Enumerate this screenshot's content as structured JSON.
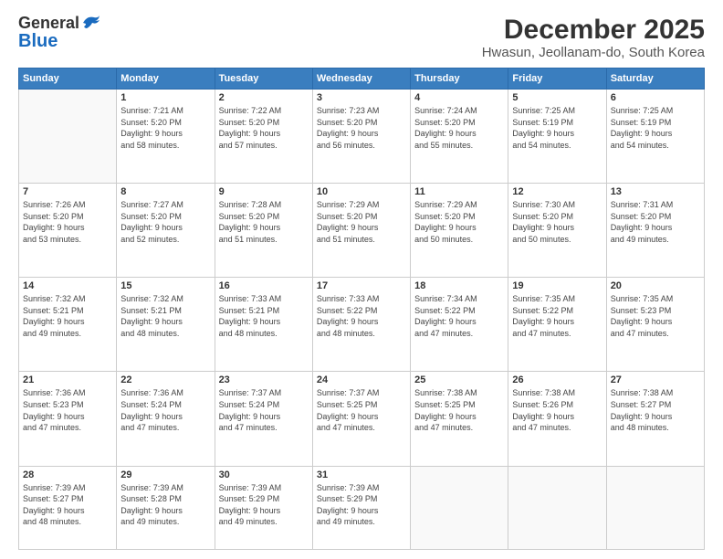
{
  "logo": {
    "general": "General",
    "blue": "Blue"
  },
  "title": "December 2025",
  "subtitle": "Hwasun, Jeollanam-do, South Korea",
  "days_of_week": [
    "Sunday",
    "Monday",
    "Tuesday",
    "Wednesday",
    "Thursday",
    "Friday",
    "Saturday"
  ],
  "weeks": [
    [
      {
        "day": "",
        "info": ""
      },
      {
        "day": "1",
        "info": "Sunrise: 7:21 AM\nSunset: 5:20 PM\nDaylight: 9 hours\nand 58 minutes."
      },
      {
        "day": "2",
        "info": "Sunrise: 7:22 AM\nSunset: 5:20 PM\nDaylight: 9 hours\nand 57 minutes."
      },
      {
        "day": "3",
        "info": "Sunrise: 7:23 AM\nSunset: 5:20 PM\nDaylight: 9 hours\nand 56 minutes."
      },
      {
        "day": "4",
        "info": "Sunrise: 7:24 AM\nSunset: 5:20 PM\nDaylight: 9 hours\nand 55 minutes."
      },
      {
        "day": "5",
        "info": "Sunrise: 7:25 AM\nSunset: 5:19 PM\nDaylight: 9 hours\nand 54 minutes."
      },
      {
        "day": "6",
        "info": "Sunrise: 7:25 AM\nSunset: 5:19 PM\nDaylight: 9 hours\nand 54 minutes."
      }
    ],
    [
      {
        "day": "7",
        "info": "Sunrise: 7:26 AM\nSunset: 5:20 PM\nDaylight: 9 hours\nand 53 minutes."
      },
      {
        "day": "8",
        "info": "Sunrise: 7:27 AM\nSunset: 5:20 PM\nDaylight: 9 hours\nand 52 minutes."
      },
      {
        "day": "9",
        "info": "Sunrise: 7:28 AM\nSunset: 5:20 PM\nDaylight: 9 hours\nand 51 minutes."
      },
      {
        "day": "10",
        "info": "Sunrise: 7:29 AM\nSunset: 5:20 PM\nDaylight: 9 hours\nand 51 minutes."
      },
      {
        "day": "11",
        "info": "Sunrise: 7:29 AM\nSunset: 5:20 PM\nDaylight: 9 hours\nand 50 minutes."
      },
      {
        "day": "12",
        "info": "Sunrise: 7:30 AM\nSunset: 5:20 PM\nDaylight: 9 hours\nand 50 minutes."
      },
      {
        "day": "13",
        "info": "Sunrise: 7:31 AM\nSunset: 5:20 PM\nDaylight: 9 hours\nand 49 minutes."
      }
    ],
    [
      {
        "day": "14",
        "info": "Sunrise: 7:32 AM\nSunset: 5:21 PM\nDaylight: 9 hours\nand 49 minutes."
      },
      {
        "day": "15",
        "info": "Sunrise: 7:32 AM\nSunset: 5:21 PM\nDaylight: 9 hours\nand 48 minutes."
      },
      {
        "day": "16",
        "info": "Sunrise: 7:33 AM\nSunset: 5:21 PM\nDaylight: 9 hours\nand 48 minutes."
      },
      {
        "day": "17",
        "info": "Sunrise: 7:33 AM\nSunset: 5:22 PM\nDaylight: 9 hours\nand 48 minutes."
      },
      {
        "day": "18",
        "info": "Sunrise: 7:34 AM\nSunset: 5:22 PM\nDaylight: 9 hours\nand 47 minutes."
      },
      {
        "day": "19",
        "info": "Sunrise: 7:35 AM\nSunset: 5:22 PM\nDaylight: 9 hours\nand 47 minutes."
      },
      {
        "day": "20",
        "info": "Sunrise: 7:35 AM\nSunset: 5:23 PM\nDaylight: 9 hours\nand 47 minutes."
      }
    ],
    [
      {
        "day": "21",
        "info": "Sunrise: 7:36 AM\nSunset: 5:23 PM\nDaylight: 9 hours\nand 47 minutes."
      },
      {
        "day": "22",
        "info": "Sunrise: 7:36 AM\nSunset: 5:24 PM\nDaylight: 9 hours\nand 47 minutes."
      },
      {
        "day": "23",
        "info": "Sunrise: 7:37 AM\nSunset: 5:24 PM\nDaylight: 9 hours\nand 47 minutes."
      },
      {
        "day": "24",
        "info": "Sunrise: 7:37 AM\nSunset: 5:25 PM\nDaylight: 9 hours\nand 47 minutes."
      },
      {
        "day": "25",
        "info": "Sunrise: 7:38 AM\nSunset: 5:25 PM\nDaylight: 9 hours\nand 47 minutes."
      },
      {
        "day": "26",
        "info": "Sunrise: 7:38 AM\nSunset: 5:26 PM\nDaylight: 9 hours\nand 47 minutes."
      },
      {
        "day": "27",
        "info": "Sunrise: 7:38 AM\nSunset: 5:27 PM\nDaylight: 9 hours\nand 48 minutes."
      }
    ],
    [
      {
        "day": "28",
        "info": "Sunrise: 7:39 AM\nSunset: 5:27 PM\nDaylight: 9 hours\nand 48 minutes."
      },
      {
        "day": "29",
        "info": "Sunrise: 7:39 AM\nSunset: 5:28 PM\nDaylight: 9 hours\nand 49 minutes."
      },
      {
        "day": "30",
        "info": "Sunrise: 7:39 AM\nSunset: 5:29 PM\nDaylight: 9 hours\nand 49 minutes."
      },
      {
        "day": "31",
        "info": "Sunrise: 7:39 AM\nSunset: 5:29 PM\nDaylight: 9 hours\nand 49 minutes."
      },
      {
        "day": "",
        "info": ""
      },
      {
        "day": "",
        "info": ""
      },
      {
        "day": "",
        "info": ""
      }
    ]
  ],
  "colors": {
    "header_bg": "#3a7ebf",
    "header_text": "#ffffff",
    "border": "#cccccc",
    "text": "#333333",
    "empty_bg": "#f9f9f9"
  }
}
